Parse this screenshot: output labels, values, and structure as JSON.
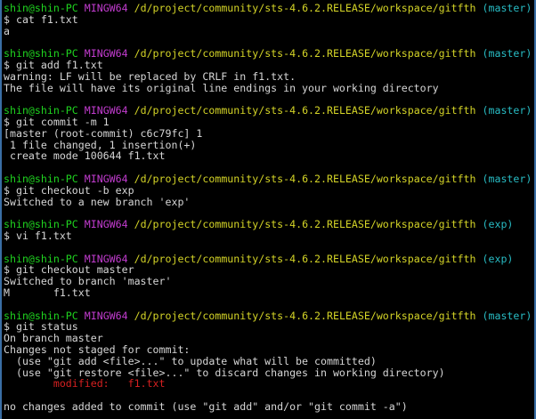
{
  "blocks": [
    {
      "prompt": {
        "user": "shin@shin-PC",
        "system": "MINGW64",
        "path": "/d/project/community/sts-4.6.2.RELEASE/workspace/gitfth",
        "branch": "(master)"
      },
      "command": "$ cat f1.txt",
      "output": [
        "a"
      ]
    },
    {
      "prompt": {
        "user": "shin@shin-PC",
        "system": "MINGW64",
        "path": "/d/project/community/sts-4.6.2.RELEASE/workspace/gitfth",
        "branch": "(master)"
      },
      "command": "$ git add f1.txt",
      "output": [
        "warning: LF will be replaced by CRLF in f1.txt.",
        "The file will have its original line endings in your working directory"
      ]
    },
    {
      "prompt": {
        "user": "shin@shin-PC",
        "system": "MINGW64",
        "path": "/d/project/community/sts-4.6.2.RELEASE/workspace/gitfth",
        "branch": "(master)"
      },
      "command": "$ git commit -m 1",
      "output": [
        "[master (root-commit) c6c79fc] 1",
        " 1 file changed, 1 insertion(+)",
        " create mode 100644 f1.txt"
      ]
    },
    {
      "prompt": {
        "user": "shin@shin-PC",
        "system": "MINGW64",
        "path": "/d/project/community/sts-4.6.2.RELEASE/workspace/gitfth",
        "branch": "(master)"
      },
      "command": "$ git checkout -b exp",
      "output": [
        "Switched to a new branch 'exp'"
      ]
    },
    {
      "prompt": {
        "user": "shin@shin-PC",
        "system": "MINGW64",
        "path": "/d/project/community/sts-4.6.2.RELEASE/workspace/gitfth",
        "branch": "(exp)"
      },
      "command": "$ vi f1.txt",
      "output": []
    },
    {
      "prompt": {
        "user": "shin@shin-PC",
        "system": "MINGW64",
        "path": "/d/project/community/sts-4.6.2.RELEASE/workspace/gitfth",
        "branch": "(exp)"
      },
      "command": "$ git checkout master",
      "output": [
        "Switched to branch 'master'",
        "M       f1.txt"
      ]
    },
    {
      "prompt": {
        "user": "shin@shin-PC",
        "system": "MINGW64",
        "path": "/d/project/community/sts-4.6.2.RELEASE/workspace/gitfth",
        "branch": "(master)"
      },
      "command": "$ git status",
      "output": [
        "On branch master",
        "Changes not staged for commit:",
        "  (use \"git add <file>...\" to update what will be committed)",
        "  (use \"git restore <file>...\" to discard changes in working directory)"
      ],
      "modified_line": {
        "indent": "        ",
        "label": "modified:",
        "file": "f1.txt"
      },
      "trailer": "no changes added to commit (use \"git add\" and/or \"git commit -a\")"
    }
  ],
  "colors": {
    "background": "#000000",
    "user": "#1fd31f",
    "system": "#c23ccf",
    "path": "#d4d427",
    "branch": "#28bcc4",
    "output": "#d6d6d6",
    "modified": "#d52020"
  }
}
